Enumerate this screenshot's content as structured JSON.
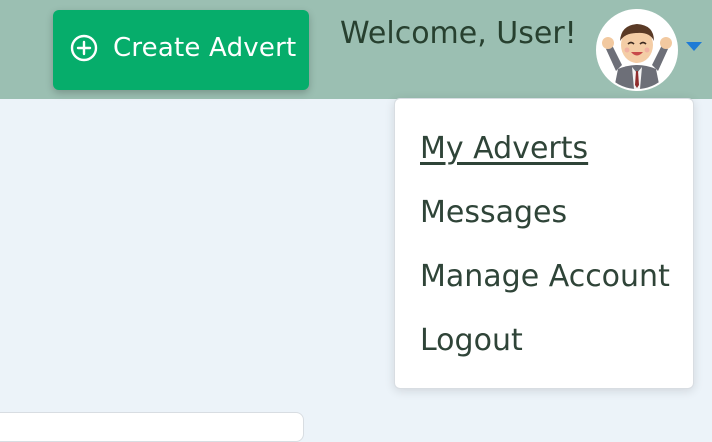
{
  "header": {
    "create_button_label": "Create Advert",
    "welcome_text": "Welcome, User!",
    "avatar_alt": "User avatar"
  },
  "dropdown": {
    "items": [
      {
        "label": "My Adverts",
        "active": true
      },
      {
        "label": "Messages"
      },
      {
        "label": "Manage Account"
      },
      {
        "label": "Logout"
      }
    ]
  },
  "colors": {
    "header_bg": "#9bbfb2",
    "button_bg": "#06ad6b",
    "page_bg": "#ecf3f9",
    "caret": "#1e7bd6",
    "menu_text": "#2f4438"
  },
  "icons": {
    "create": "plus-circle-icon",
    "caret": "caret-down-icon"
  }
}
